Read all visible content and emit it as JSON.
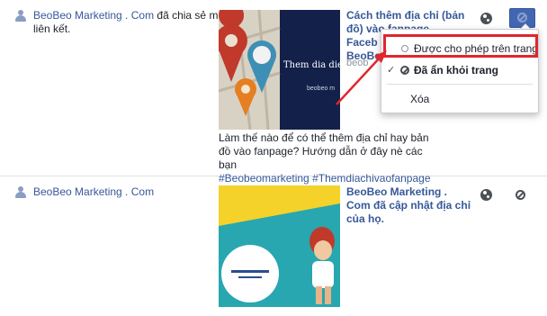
{
  "posts": [
    {
      "poster_name": "BeoBeo Marketing . Com",
      "poster_action": "đã chia sẻ một liên kết.",
      "title_lines": [
        "Cách thêm địa chỉ (bản",
        "đồ) vào fanpage",
        "Faceb",
        "BeoBe",
        "beob"
      ],
      "thumb_text": "Them dia diem",
      "thumb_sub": "beobeo m",
      "caption": "Làm thế nào để có thể thêm địa chỉ hay bản đồ vào fanpage? Hướng dẫn ở đây nè các bạn",
      "tags": "#Beobeomarketing #Themdiachivaofanpage",
      "privacy_icon": "globe-icon",
      "status_icon": "ban-icon"
    },
    {
      "poster_name": "BeoBeo Marketing . Com",
      "title_lines": [
        "BeoBeo Marketing .",
        "Com đã cập nhật địa chỉ",
        "của họ."
      ],
      "privacy_icon": "globe-icon",
      "status_icon": "ban-icon"
    }
  ],
  "menu": {
    "items": [
      {
        "label": "Được cho phép trên trang",
        "icon": "radio-icon",
        "checked": false
      },
      {
        "label": "Đã ẩn khỏi trang",
        "icon": "ban-icon",
        "checked": true
      },
      {
        "label": "Xóa",
        "icon": "",
        "checked": false
      }
    ],
    "check_mark": "✓"
  },
  "colors": {
    "link": "#365899",
    "highlight": "#e0262c",
    "button": "#4267b2"
  }
}
